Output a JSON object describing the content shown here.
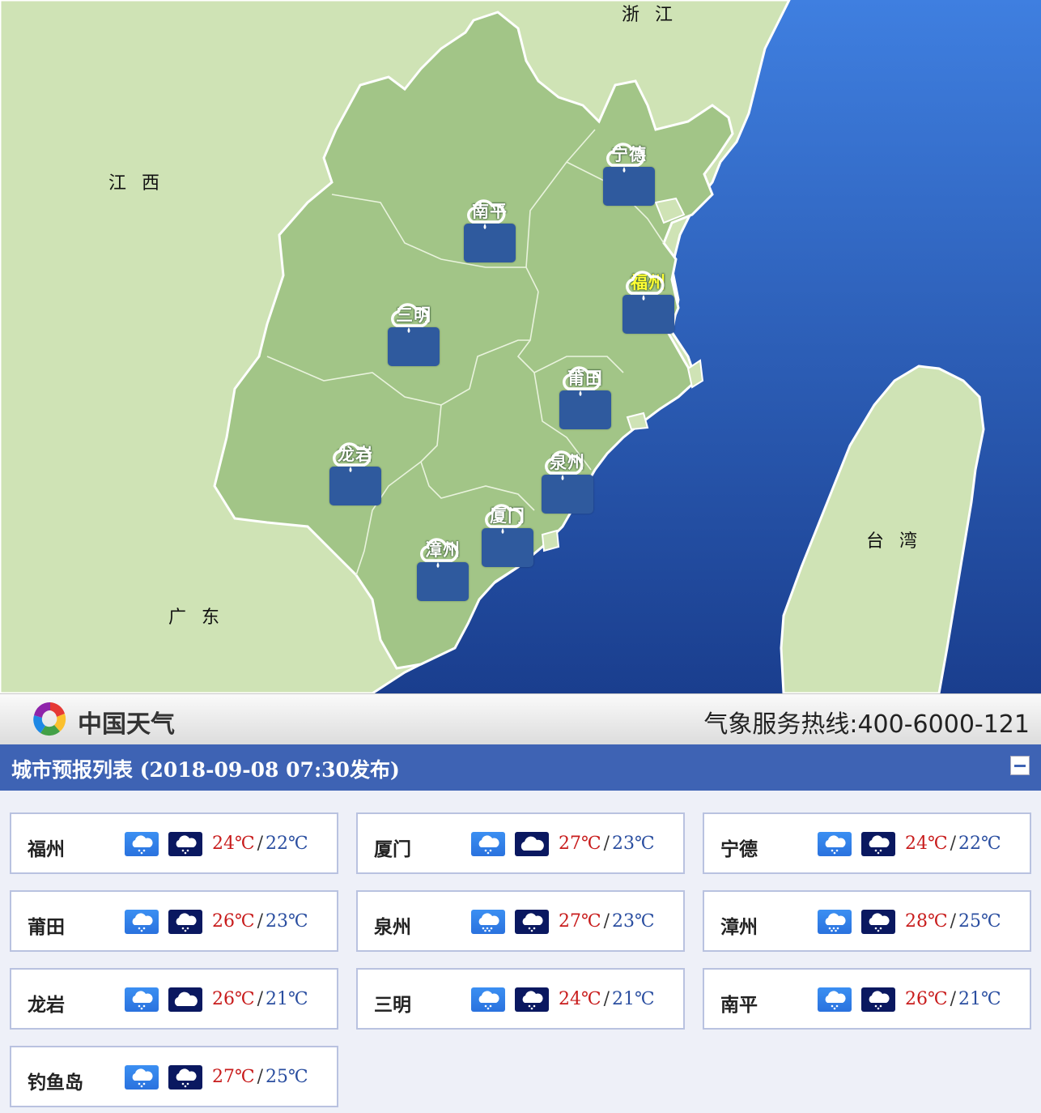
{
  "map": {
    "regions": {
      "zhejiang": "浙 江",
      "jiangxi": "江 西",
      "guangdong": "广 东",
      "taiwan": "台 湾"
    },
    "cities": [
      {
        "name": "宁德",
        "icon": "rain-cloud-icon",
        "highlight": false
      },
      {
        "name": "南平",
        "icon": "rain-cloud-icon",
        "highlight": false
      },
      {
        "name": "福州",
        "icon": "rain-cloud-icon",
        "highlight": true
      },
      {
        "name": "三明",
        "icon": "rain-cloud-icon",
        "highlight": false
      },
      {
        "name": "莆田",
        "icon": "rain-cloud-icon",
        "highlight": false
      },
      {
        "name": "泉州",
        "icon": "rain-cloud-icon",
        "highlight": false
      },
      {
        "name": "龙岩",
        "icon": "rain-cloud-icon",
        "highlight": false
      },
      {
        "name": "厦门",
        "icon": "rain-cloud-icon",
        "highlight": false
      },
      {
        "name": "漳州",
        "icon": "rain-cloud-icon",
        "highlight": false
      }
    ]
  },
  "brand": {
    "name": "中国天气",
    "logo_icon": "weather-china-logo-icon",
    "hotline": "气象服务热线:400-6000-121"
  },
  "list": {
    "title": "城市预报列表 (2018-09-08 07:30发布)",
    "collapse_icon": "minus-icon",
    "cities": [
      {
        "name": "福州",
        "day_icon": "light-rain-icon",
        "night_icon": "light-rain-icon",
        "high": "24℃",
        "low": "22℃"
      },
      {
        "name": "厦门",
        "day_icon": "light-rain-icon",
        "night_icon": "cloudy-icon",
        "high": "27℃",
        "low": "23℃"
      },
      {
        "name": "宁德",
        "day_icon": "light-rain-icon",
        "night_icon": "light-rain-icon",
        "high": "24℃",
        "low": "22℃"
      },
      {
        "name": "莆田",
        "day_icon": "light-rain-icon",
        "night_icon": "light-rain-icon",
        "high": "26℃",
        "low": "23℃"
      },
      {
        "name": "泉州",
        "day_icon": "moderate-rain-icon",
        "night_icon": "light-rain-icon",
        "high": "27℃",
        "low": "23℃"
      },
      {
        "name": "漳州",
        "day_icon": "moderate-rain-icon",
        "night_icon": "light-rain-icon",
        "high": "28℃",
        "low": "25℃"
      },
      {
        "name": "龙岩",
        "day_icon": "light-rain-icon",
        "night_icon": "cloudy-icon",
        "high": "26℃",
        "low": "21℃"
      },
      {
        "name": "三明",
        "day_icon": "light-rain-icon",
        "night_icon": "light-rain-icon",
        "high": "24℃",
        "low": "21℃"
      },
      {
        "name": "南平",
        "day_icon": "light-rain-icon",
        "night_icon": "light-rain-icon",
        "high": "26℃",
        "low": "21℃"
      },
      {
        "name": "钓鱼岛",
        "day_icon": "light-rain-icon",
        "night_icon": "light-rain-icon",
        "high": "27℃",
        "low": "25℃"
      }
    ]
  },
  "colors": {
    "sea_top": "#3f7fe0",
    "sea_bottom": "#1a3e8e",
    "land_outside": "#cfe3b5",
    "land_fujian": "#a2c587",
    "header_bg": "#3e63b4",
    "temp_high": "#c81c1c",
    "temp_low": "#2a4ea0"
  }
}
